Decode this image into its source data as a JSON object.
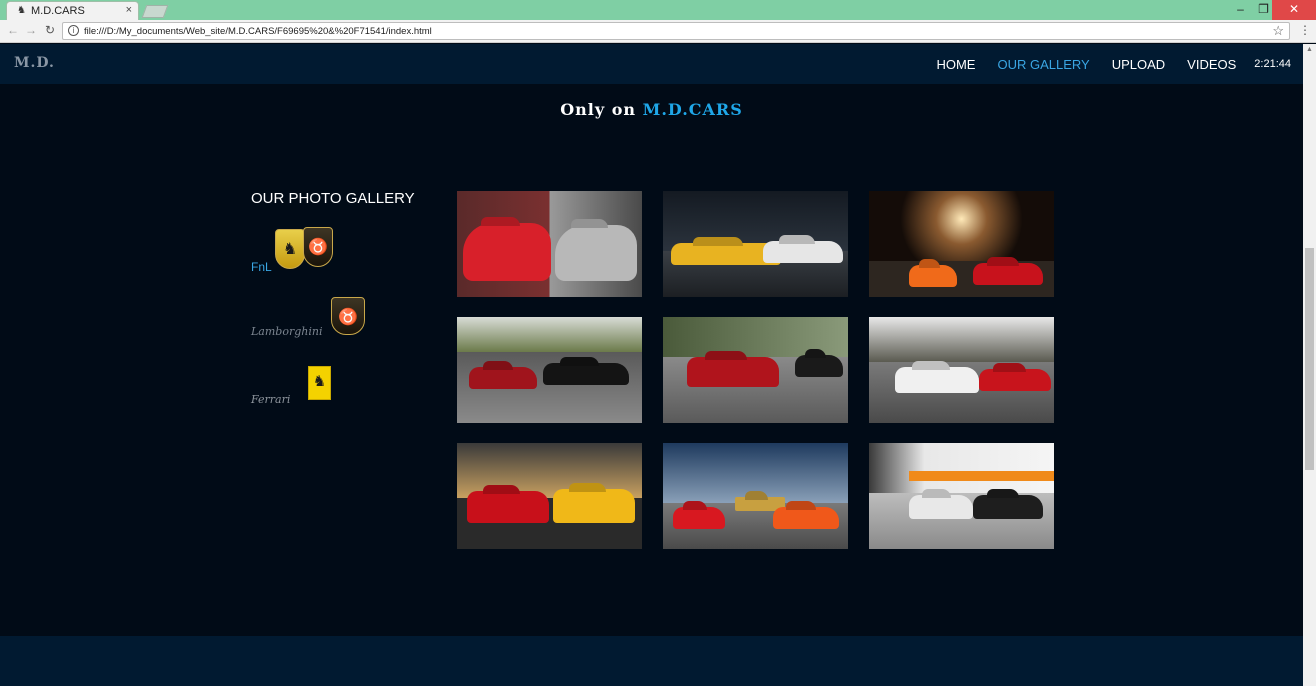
{
  "browser": {
    "tab_title": "M.D.CARS",
    "tab_close": "×",
    "url": "file:///D:/My_documents/Web_site/M.D.CARS/F69695%20&%20F71541/index.html",
    "win_min": "–",
    "win_max": "❐",
    "win_close": "✕"
  },
  "header": {
    "logo": "M.D.",
    "nav": [
      {
        "label": "HOME"
      },
      {
        "label": "OUR GALLERY"
      },
      {
        "label": "UPLOAD"
      },
      {
        "label": "VIDEOS"
      }
    ],
    "clock": "2:21:44",
    "active_color": "#3aa6e3"
  },
  "tagline": {
    "prefix": "Only on ",
    "brand": "M.D.CARS"
  },
  "sidebar": {
    "heading": "OUR PHOTO GALLERY",
    "fnl": "FnL",
    "lamborghini": "Lamborghini",
    "ferrari": "Ferrari"
  },
  "photos": [
    {
      "caption": "Red and grey supercars split view"
    },
    {
      "caption": "Yellow and white supercars at night"
    },
    {
      "caption": "Orange and red supercars by ferris wheel"
    },
    {
      "caption": "Red and black classic supercars on road"
    },
    {
      "caption": "Red classic supercar drifting"
    },
    {
      "caption": "White and red supercars in lot"
    },
    {
      "caption": "Red and yellow supercars at sunset"
    },
    {
      "caption": "Supercars with vintage plane"
    },
    {
      "caption": "White and black supercars in garage"
    }
  ],
  "colors": {
    "page_bg": "#010b17",
    "header_bg": "#011a31",
    "brand_blue": "#1fa7e8"
  }
}
